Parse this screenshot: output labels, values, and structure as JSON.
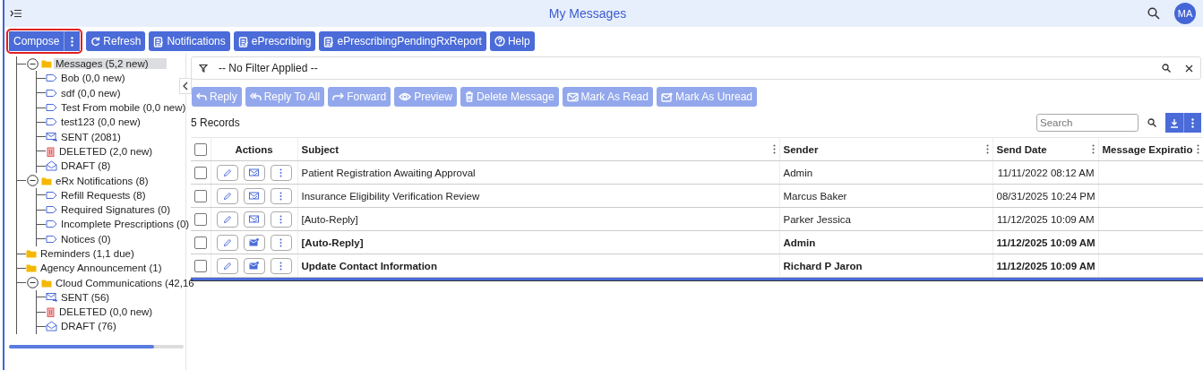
{
  "header": {
    "title": "My Messages",
    "avatar": "MA"
  },
  "toolbar": {
    "compose": {
      "label": "Compose",
      "highlighted": true
    },
    "buttons": [
      {
        "label": "Refresh",
        "kind": "refresh"
      },
      {
        "label": "Notifications",
        "kind": "clipboard"
      },
      {
        "label": "ePrescribing",
        "kind": "clipboard"
      },
      {
        "label": "ePrescribingPendingRxReport",
        "kind": "clipboard"
      },
      {
        "label": "Help",
        "kind": "help"
      }
    ]
  },
  "sidebar": {
    "tree": [
      {
        "label": "Messages (5,2 new)",
        "kind": "folder",
        "expanded": true,
        "selected": true,
        "children": [
          {
            "label": "Bob (0,0 new)",
            "kind": "tag",
            "selected": false
          },
          {
            "label": "sdf (0,0 new)",
            "kind": "tag",
            "selected": false
          },
          {
            "label": "Test From mobile (0,0 new)",
            "kind": "tag",
            "selected": false
          },
          {
            "label": "test123 (0,0 new)",
            "kind": "tag",
            "selected": false
          },
          {
            "label": "SENT (2081)",
            "kind": "sent",
            "selected": false
          },
          {
            "label": "DELETED (2,0 new)",
            "kind": "deleted",
            "selected": false
          },
          {
            "label": "DRAFT (8)",
            "kind": "draft",
            "selected": false
          }
        ]
      },
      {
        "label": "eRx Notifications (8)",
        "kind": "folder",
        "expanded": true,
        "selected": false,
        "children": [
          {
            "label": "Refill Requests (8)",
            "kind": "tag",
            "selected": false
          },
          {
            "label": "Required Signatures (0)",
            "kind": "tag",
            "selected": false
          },
          {
            "label": "Incomplete Prescriptions (0)",
            "kind": "tag",
            "selected": false
          },
          {
            "label": "Notices (0)",
            "kind": "tag",
            "selected": false
          }
        ]
      },
      {
        "label": "Reminders (1,1 due)",
        "kind": "folder",
        "selected": false
      },
      {
        "label": "Agency Announcement (1)",
        "kind": "folder",
        "selected": false
      },
      {
        "label": "Cloud Communications (42,16",
        "kind": "folder",
        "expanded": true,
        "selected": false,
        "children": [
          {
            "label": "SENT (56)",
            "kind": "sent",
            "selected": false
          },
          {
            "label": "DELETED (0,0 new)",
            "kind": "deleted",
            "selected": false
          },
          {
            "label": "DRAFT (76)",
            "kind": "draft",
            "selected": false
          }
        ]
      }
    ]
  },
  "filter": {
    "text": "-- No Filter Applied --"
  },
  "actions": [
    {
      "label": "Reply",
      "kind": "reply",
      "disabled": true
    },
    {
      "label": "Reply To All",
      "kind": "reply-all",
      "disabled": true
    },
    {
      "label": "Forward",
      "kind": "forward",
      "disabled": true
    },
    {
      "label": "Preview",
      "kind": "preview",
      "disabled": true
    },
    {
      "label": "Delete Message",
      "kind": "delete",
      "disabled": true
    },
    {
      "label": "Mark As Read",
      "kind": "mark-read",
      "disabled": true
    },
    {
      "label": "Mark As Unread",
      "kind": "mark-unread",
      "disabled": true
    }
  ],
  "records": "5 Records",
  "search": {
    "placeholder": "Search"
  },
  "table": {
    "select_all": false,
    "columns": [
      "Actions",
      "Subject",
      "Sender",
      "Send Date",
      "Message Expiratio"
    ],
    "rows": [
      {
        "subject": "Patient Registration Awaiting Approval",
        "sender": "Admin",
        "send_date": "11/11/2022 08:12 AM",
        "unread": false,
        "selected": false
      },
      {
        "subject": "Insurance Eligibility Verification Review",
        "sender": "Marcus Baker",
        "send_date": "08/31/2025 10:24 PM",
        "unread": false,
        "selected": false
      },
      {
        "subject": "[Auto-Reply]",
        "sender": "Parker Jessica",
        "send_date": "11/12/2025 10:09 AM",
        "unread": false,
        "selected": false
      },
      {
        "subject": "[Auto-Reply]",
        "sender": "Admin",
        "send_date": "11/12/2025 10:09 AM",
        "unread": true,
        "selected": false
      },
      {
        "subject": "Update Contact Information",
        "sender": "Richard P Jaron",
        "send_date": "11/12/2025 10:09 AM",
        "unread": true,
        "selected": false
      }
    ]
  }
}
